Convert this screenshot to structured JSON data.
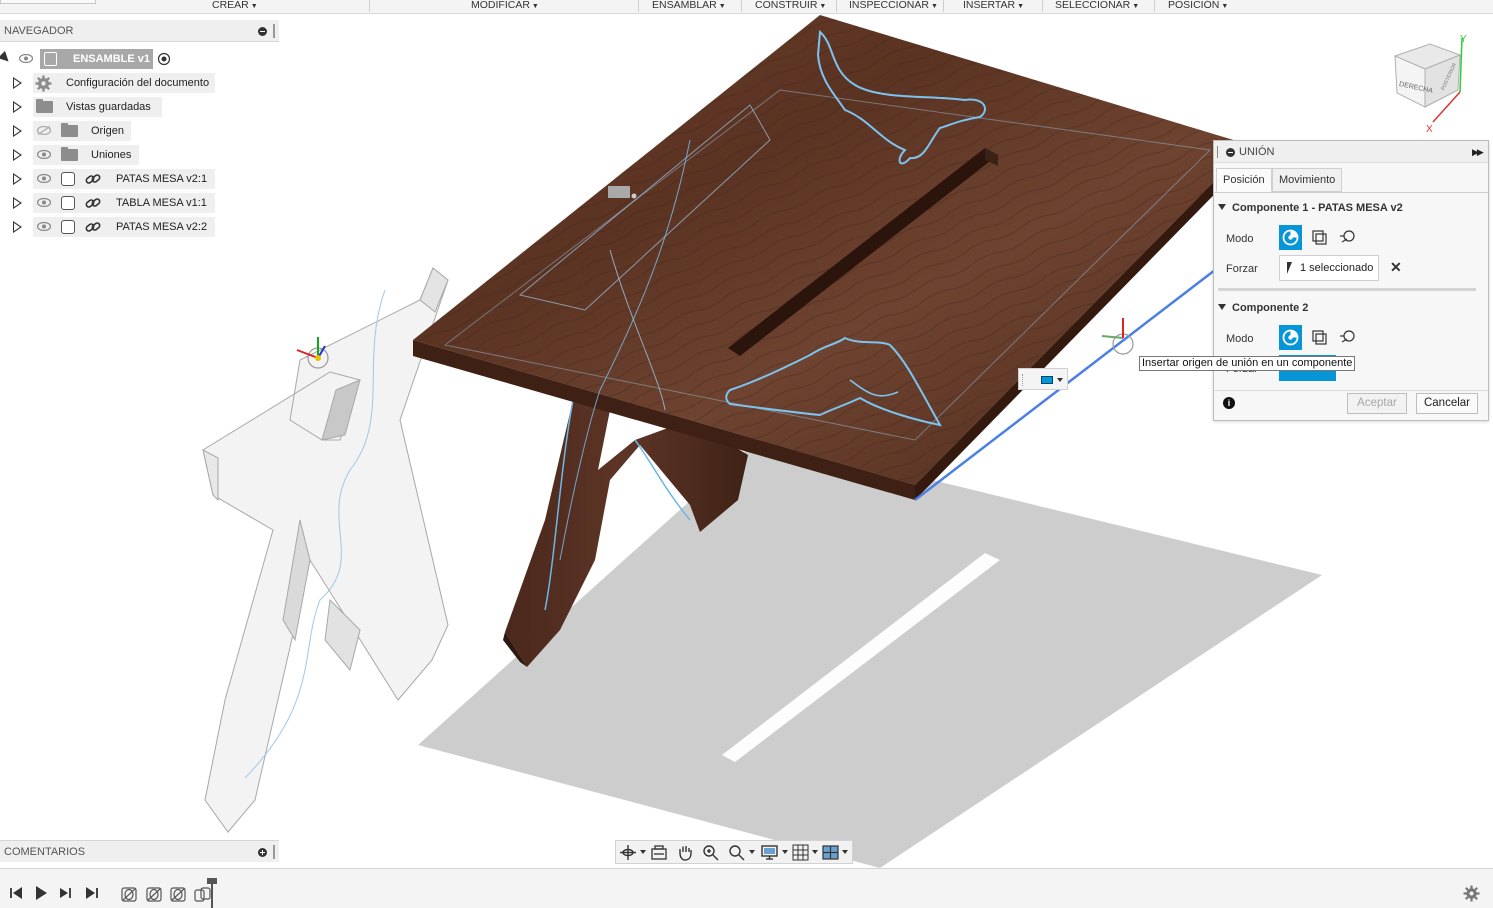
{
  "toolbar": {
    "crear": "CREAR",
    "modificar": "MODIFICAR",
    "ensamblar": "ENSAMBLAR",
    "construir": "CONSTRUIR",
    "inspeccionar": "INSPECCIONAR",
    "insertar": "INSERTAR",
    "seleccionar": "SELECCIONAR",
    "posicion": "POSICIÓN"
  },
  "navigator": {
    "title": "NAVEGADOR",
    "root": "ENSAMBLE v1",
    "items": [
      {
        "label": "Configuración del documento",
        "icon": "gear-icon"
      },
      {
        "label": "Vistas guardadas",
        "icon": "folder-icon"
      },
      {
        "label": "Origen",
        "icon": "folder-icon",
        "hidden": true
      },
      {
        "label": "Uniones",
        "icon": "folder-icon"
      },
      {
        "label": "PATAS MESA v2:1",
        "icon": "component-icon"
      },
      {
        "label": "TABLA MESA v1:1",
        "icon": "component-icon"
      },
      {
        "label": "PATAS MESA v2:2",
        "icon": "component-icon"
      }
    ]
  },
  "viewcube": {
    "face_right": "DERECHA",
    "face_back": "POSTERIOR",
    "axis_x": "X",
    "axis_y": "Y"
  },
  "comments": {
    "title": "COMENTARIOS"
  },
  "joint_panel": {
    "title": "UNIÓN",
    "tabs": [
      "Posición",
      "Movimiento"
    ],
    "active_tab": "Posición",
    "component1": {
      "header": "Componente 1 - PATAS MESA v2",
      "mode_label": "Modo",
      "snap_label": "Forzar",
      "snap_value": "1 seleccionado"
    },
    "component2": {
      "header": "Componente 2",
      "mode_label": "Modo",
      "snap_label": "Forzar"
    },
    "ok": "Aceptar",
    "cancel": "Cancelar"
  },
  "tooltip": "Insertar origen de unión en un componente",
  "colors": {
    "accent": "#0696d7",
    "wood": "#5a3424",
    "shadow": "#cfcfcf"
  }
}
